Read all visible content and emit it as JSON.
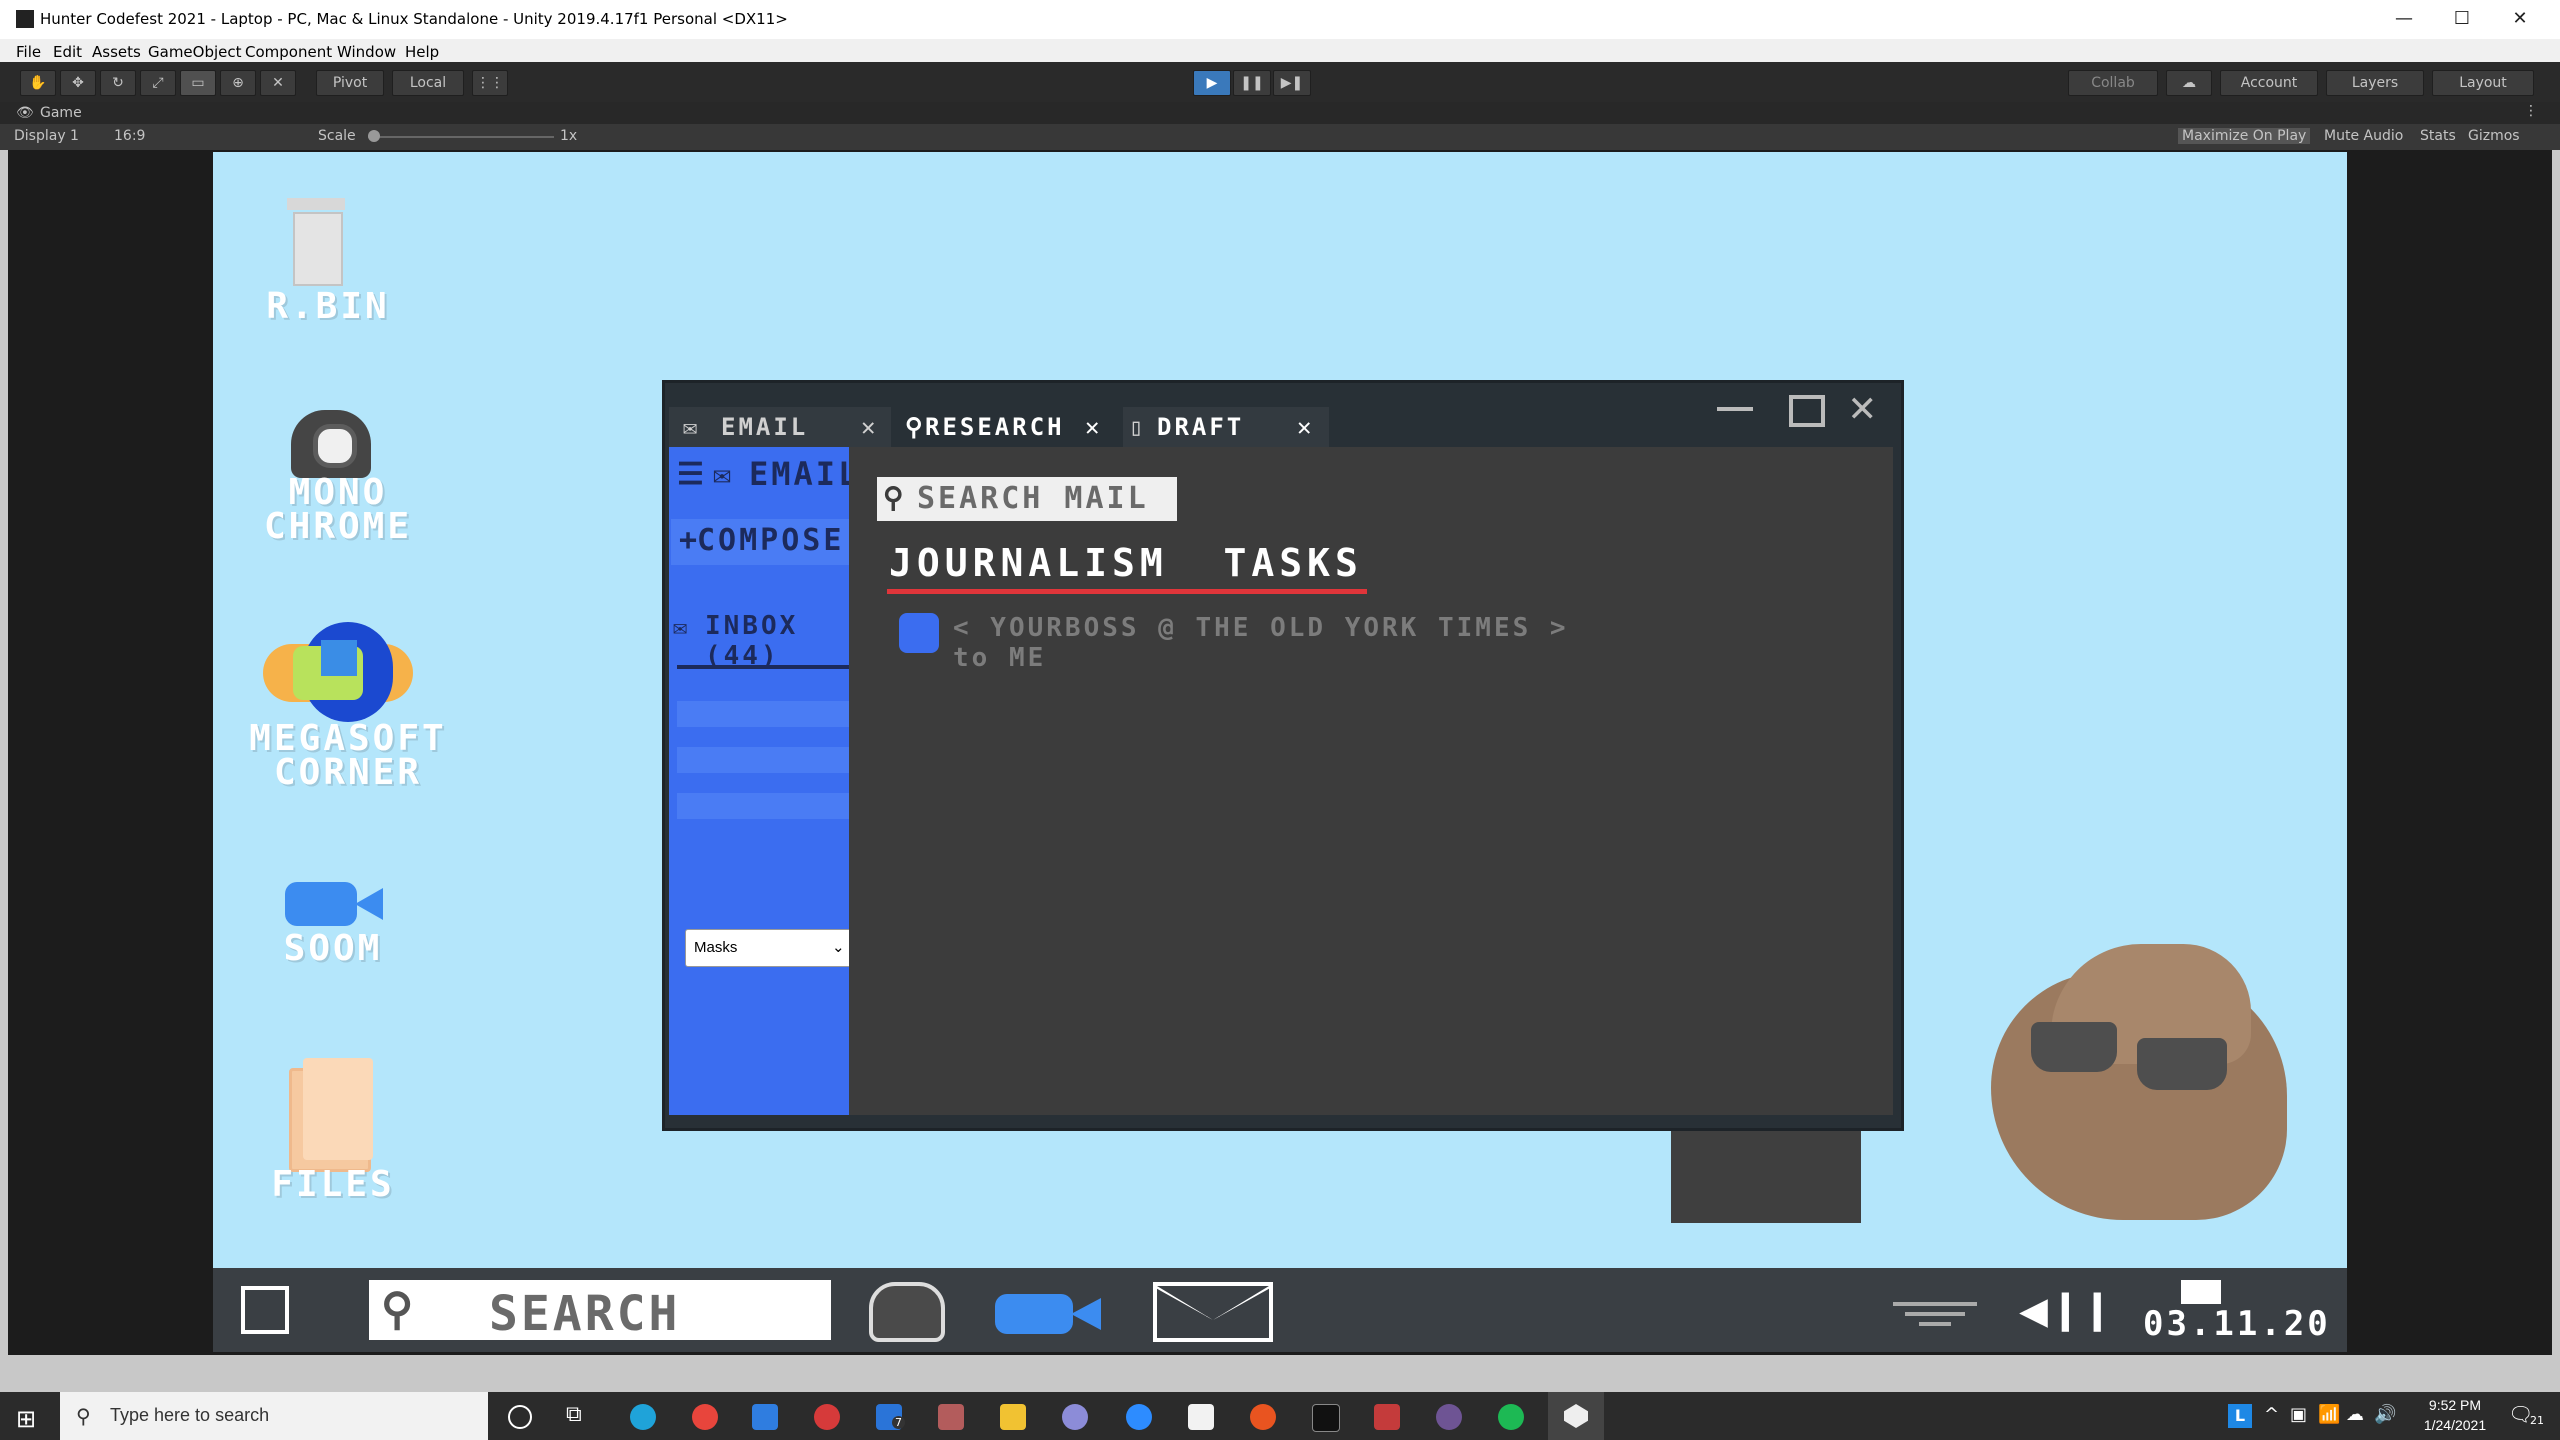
{
  "window": {
    "title": "Hunter Codefest 2021 - Laptop - PC, Mac & Linux Standalone - Unity 2019.4.17f1 Personal <DX11>",
    "minimize": "—",
    "maximize": "☐",
    "close": "✕"
  },
  "menu": [
    "File",
    "Edit",
    "Assets",
    "GameObject",
    "Component",
    "Window",
    "Help"
  ],
  "toolbar": {
    "pivot": "Pivot",
    "local": "Local",
    "collab": "Collab",
    "account": "Account",
    "layers": "Layers",
    "layout": "Layout"
  },
  "game_panel": {
    "tab": "Game",
    "display": "Display 1",
    "aspect": "16:9",
    "scale_label": "Scale",
    "scale_value": "1x",
    "maximize_on_play": "Maximize On Play",
    "mute_audio": "Mute Audio",
    "stats": "Stats",
    "gizmos": "Gizmos"
  },
  "desktop_icons": [
    {
      "label": "R.BIN",
      "icon": "recycle-bin-icon"
    },
    {
      "label": "MONO CHROME",
      "icon": "browser-icon"
    },
    {
      "label": "MEGASOFT CORNER",
      "icon": "globe-icon"
    },
    {
      "label": "SOOM",
      "icon": "camera-icon"
    },
    {
      "label": "FILES",
      "icon": "folder-icon"
    }
  ],
  "mail_app": {
    "tabs": [
      {
        "label": "EMAIL",
        "icon": "mail-icon",
        "active": false
      },
      {
        "label": "RESEARCH",
        "icon": "search-icon",
        "active": true
      },
      {
        "label": "DRAFT",
        "icon": "doc-icon",
        "active": false
      }
    ],
    "sidebar": {
      "header": "EMAIL",
      "compose": "COMPOSE",
      "inbox": "INBOX (44)",
      "dropdown_value": "Masks"
    },
    "search_placeholder": "SEARCH MAIL",
    "heading": "JOURNALISM  TASKS",
    "message_from": "< YOURBOSS @ THE OLD YORK TIMES >",
    "message_to": "to ME"
  },
  "game_taskbar": {
    "search_placeholder": "SEARCH",
    "clock": "03.11.20"
  },
  "os_taskbar": {
    "search_placeholder": "Type here to search",
    "time": "9:52 PM",
    "date": "1/24/2021",
    "notif_count": "21",
    "mail_badge": "7"
  },
  "colors": {
    "desktop_bg": "#b4e6fb",
    "sidebar_blue": "#3b6df0",
    "accent_red": "#e0353a"
  }
}
